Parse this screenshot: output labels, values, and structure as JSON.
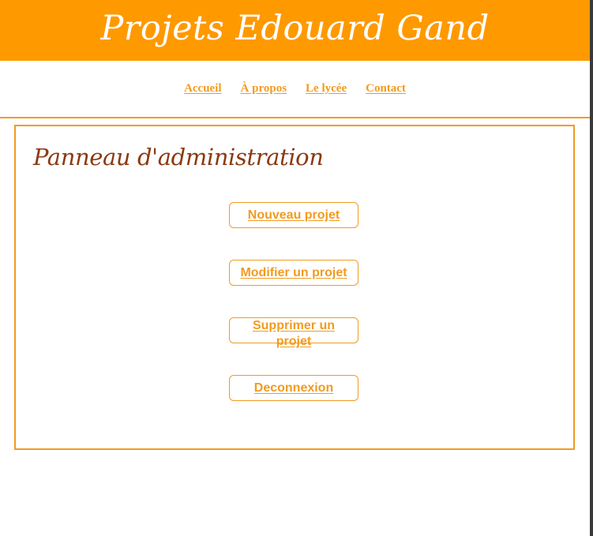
{
  "header": {
    "title": "Projets Edouard Gand"
  },
  "nav": {
    "items": [
      {
        "label": "Accueil"
      },
      {
        "label": "À propos"
      },
      {
        "label": "Le lycée"
      },
      {
        "label": "Contact"
      }
    ]
  },
  "admin": {
    "title": "Panneau d'administration",
    "buttons": [
      {
        "label": "Nouveau projet"
      },
      {
        "label": "Modifier un projet"
      },
      {
        "label": "Supprimer un projet"
      },
      {
        "label": "Deconnexion"
      }
    ]
  },
  "colors": {
    "header_bg": "#ff9900",
    "accent": "#f29b1f",
    "title_brown": "#8a3a12",
    "background": "#ffffff"
  }
}
